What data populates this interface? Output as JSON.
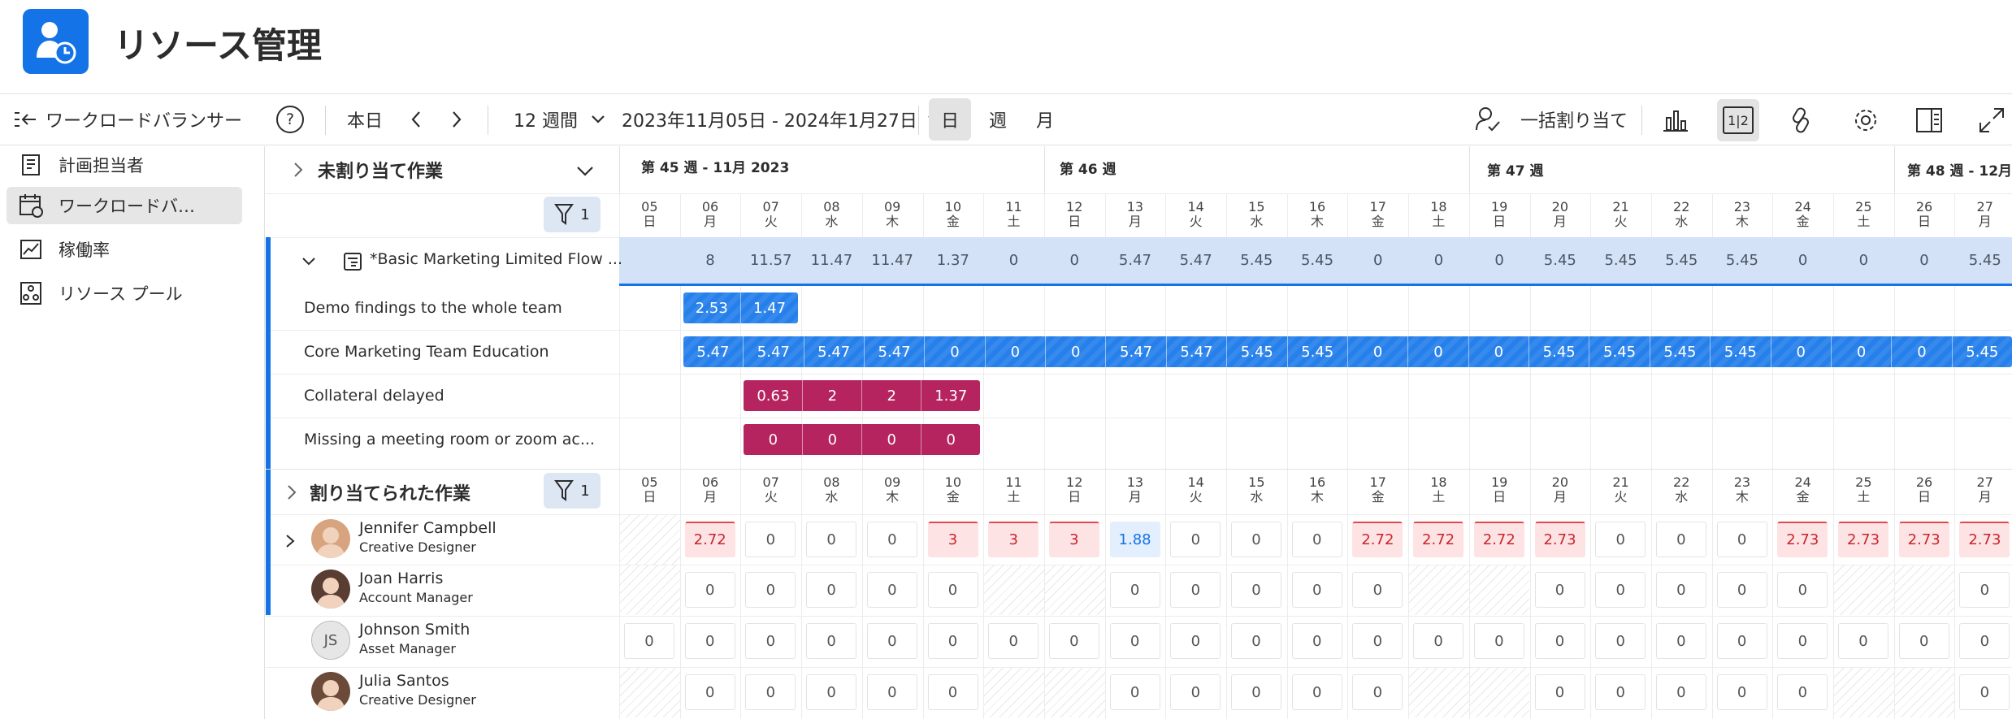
{
  "header": {
    "title": "リソース管理"
  },
  "toolbar": {
    "view_name": "ワークロードバランサー",
    "help": "?",
    "today": "本日",
    "range_select": "12 週間",
    "date_range": "2023年11月05日 - 2024年1月27日",
    "view_day": "日",
    "view_week": "週",
    "view_month": "月",
    "bulk_assign": "一括割り当て",
    "split_label": "1|2"
  },
  "sidebar": {
    "items": [
      {
        "label": "計画担当者",
        "icon": "planner-icon"
      },
      {
        "label": "ワークロードバ…",
        "icon": "workload-calendar-icon"
      },
      {
        "label": "稼働率",
        "icon": "utilization-chart-icon"
      },
      {
        "label": "リソース プール",
        "icon": "resource-pool-icon"
      }
    ]
  },
  "unassigned": {
    "title": "未割り当て作業",
    "filter_count": "1",
    "project": {
      "name": "*Basic Marketing Limited Flow ...",
      "values": [
        "8",
        "11.57",
        "11.47",
        "11.47",
        "1.37",
        "0",
        "0",
        "5.47",
        "5.47",
        "5.45",
        "5.45",
        "0",
        "0",
        "0",
        "5.45",
        "5.45",
        "5.45",
        "5.45",
        "0",
        "0",
        "0",
        "5.45"
      ]
    },
    "tasks": [
      {
        "label": "Demo findings to the whole team",
        "values": [
          "2.53",
          "1.47"
        ]
      },
      {
        "label": "Core Marketing Team Education",
        "values": [
          "5.47",
          "5.47",
          "5.47",
          "5.47",
          "0",
          "0",
          "0",
          "5.47",
          "5.47",
          "5.45",
          "5.45",
          "0",
          "0",
          "0",
          "5.45",
          "5.45",
          "5.45",
          "5.45",
          "0",
          "0",
          "0",
          "5.45"
        ]
      },
      {
        "label": "Collateral delayed",
        "values": [
          "0.63",
          "2",
          "2",
          "1.37"
        ]
      },
      {
        "label": "Missing a meeting room or zoom ac...",
        "values": [
          "0",
          "0",
          "0",
          "0"
        ]
      }
    ]
  },
  "assigned": {
    "title": "割り当てられた作業",
    "filter_count": "1",
    "users": [
      {
        "name": "Jennifer Campbell",
        "role": "Creative Designer",
        "initials": "",
        "values": [
          "",
          "2.72",
          "0",
          "0",
          "0",
          "3",
          "3",
          "3",
          "1.88",
          "0",
          "0",
          "0",
          "2.72",
          "2.72",
          "2.72",
          "2.73",
          "0",
          "0",
          "0",
          "2.73",
          "2.73",
          "2.73",
          "2.73"
        ]
      },
      {
        "name": "Joan Harris",
        "role": "Account Manager",
        "initials": "",
        "values": [
          "",
          "0",
          "0",
          "0",
          "0",
          "0",
          "",
          "",
          "0",
          "0",
          "0",
          "0",
          "0",
          "",
          "",
          "0",
          "0",
          "0",
          "0",
          "0",
          "",
          "",
          "0"
        ]
      },
      {
        "name": "Johnson Smith",
        "role": "Asset Manager",
        "initials": "JS",
        "values": [
          "0",
          "0",
          "0",
          "0",
          "0",
          "0",
          "0",
          "0",
          "0",
          "0",
          "0",
          "0",
          "0",
          "0",
          "0",
          "0",
          "0",
          "0",
          "0",
          "0",
          "0",
          "0",
          "0"
        ]
      },
      {
        "name": "Julia Santos",
        "role": "Creative Designer",
        "initials": "",
        "values": [
          "",
          "0",
          "0",
          "0",
          "0",
          "0",
          "",
          "",
          "0",
          "0",
          "0",
          "0",
          "0",
          "",
          "",
          "0",
          "0",
          "0",
          "0",
          "0",
          "",
          "",
          "0"
        ]
      }
    ]
  },
  "timeline": {
    "weeks": [
      "第 45 週 - 11月 2023",
      "第 46 週",
      "第 47 週",
      "第 48 週 - 12月"
    ],
    "days": [
      {
        "d": "05",
        "w": "日"
      },
      {
        "d": "06",
        "w": "月"
      },
      {
        "d": "07",
        "w": "火"
      },
      {
        "d": "08",
        "w": "水"
      },
      {
        "d": "09",
        "w": "木"
      },
      {
        "d": "10",
        "w": "金"
      },
      {
        "d": "11",
        "w": "土"
      },
      {
        "d": "12",
        "w": "日"
      },
      {
        "d": "13",
        "w": "月"
      },
      {
        "d": "14",
        "w": "火"
      },
      {
        "d": "15",
        "w": "水"
      },
      {
        "d": "16",
        "w": "木"
      },
      {
        "d": "17",
        "w": "金"
      },
      {
        "d": "18",
        "w": "土"
      },
      {
        "d": "19",
        "w": "日"
      },
      {
        "d": "20",
        "w": "月"
      },
      {
        "d": "21",
        "w": "火"
      },
      {
        "d": "22",
        "w": "水"
      },
      {
        "d": "23",
        "w": "木"
      },
      {
        "d": "24",
        "w": "金"
      },
      {
        "d": "25",
        "w": "土"
      },
      {
        "d": "26",
        "w": "日"
      },
      {
        "d": "27",
        "w": "月"
      }
    ]
  },
  "colors": {
    "accent": "#1473e6",
    "bar_blue": "#2680eb",
    "bar_red": "#b5245e",
    "over": "#fde3e3",
    "project_row": "#d3e2f7"
  }
}
